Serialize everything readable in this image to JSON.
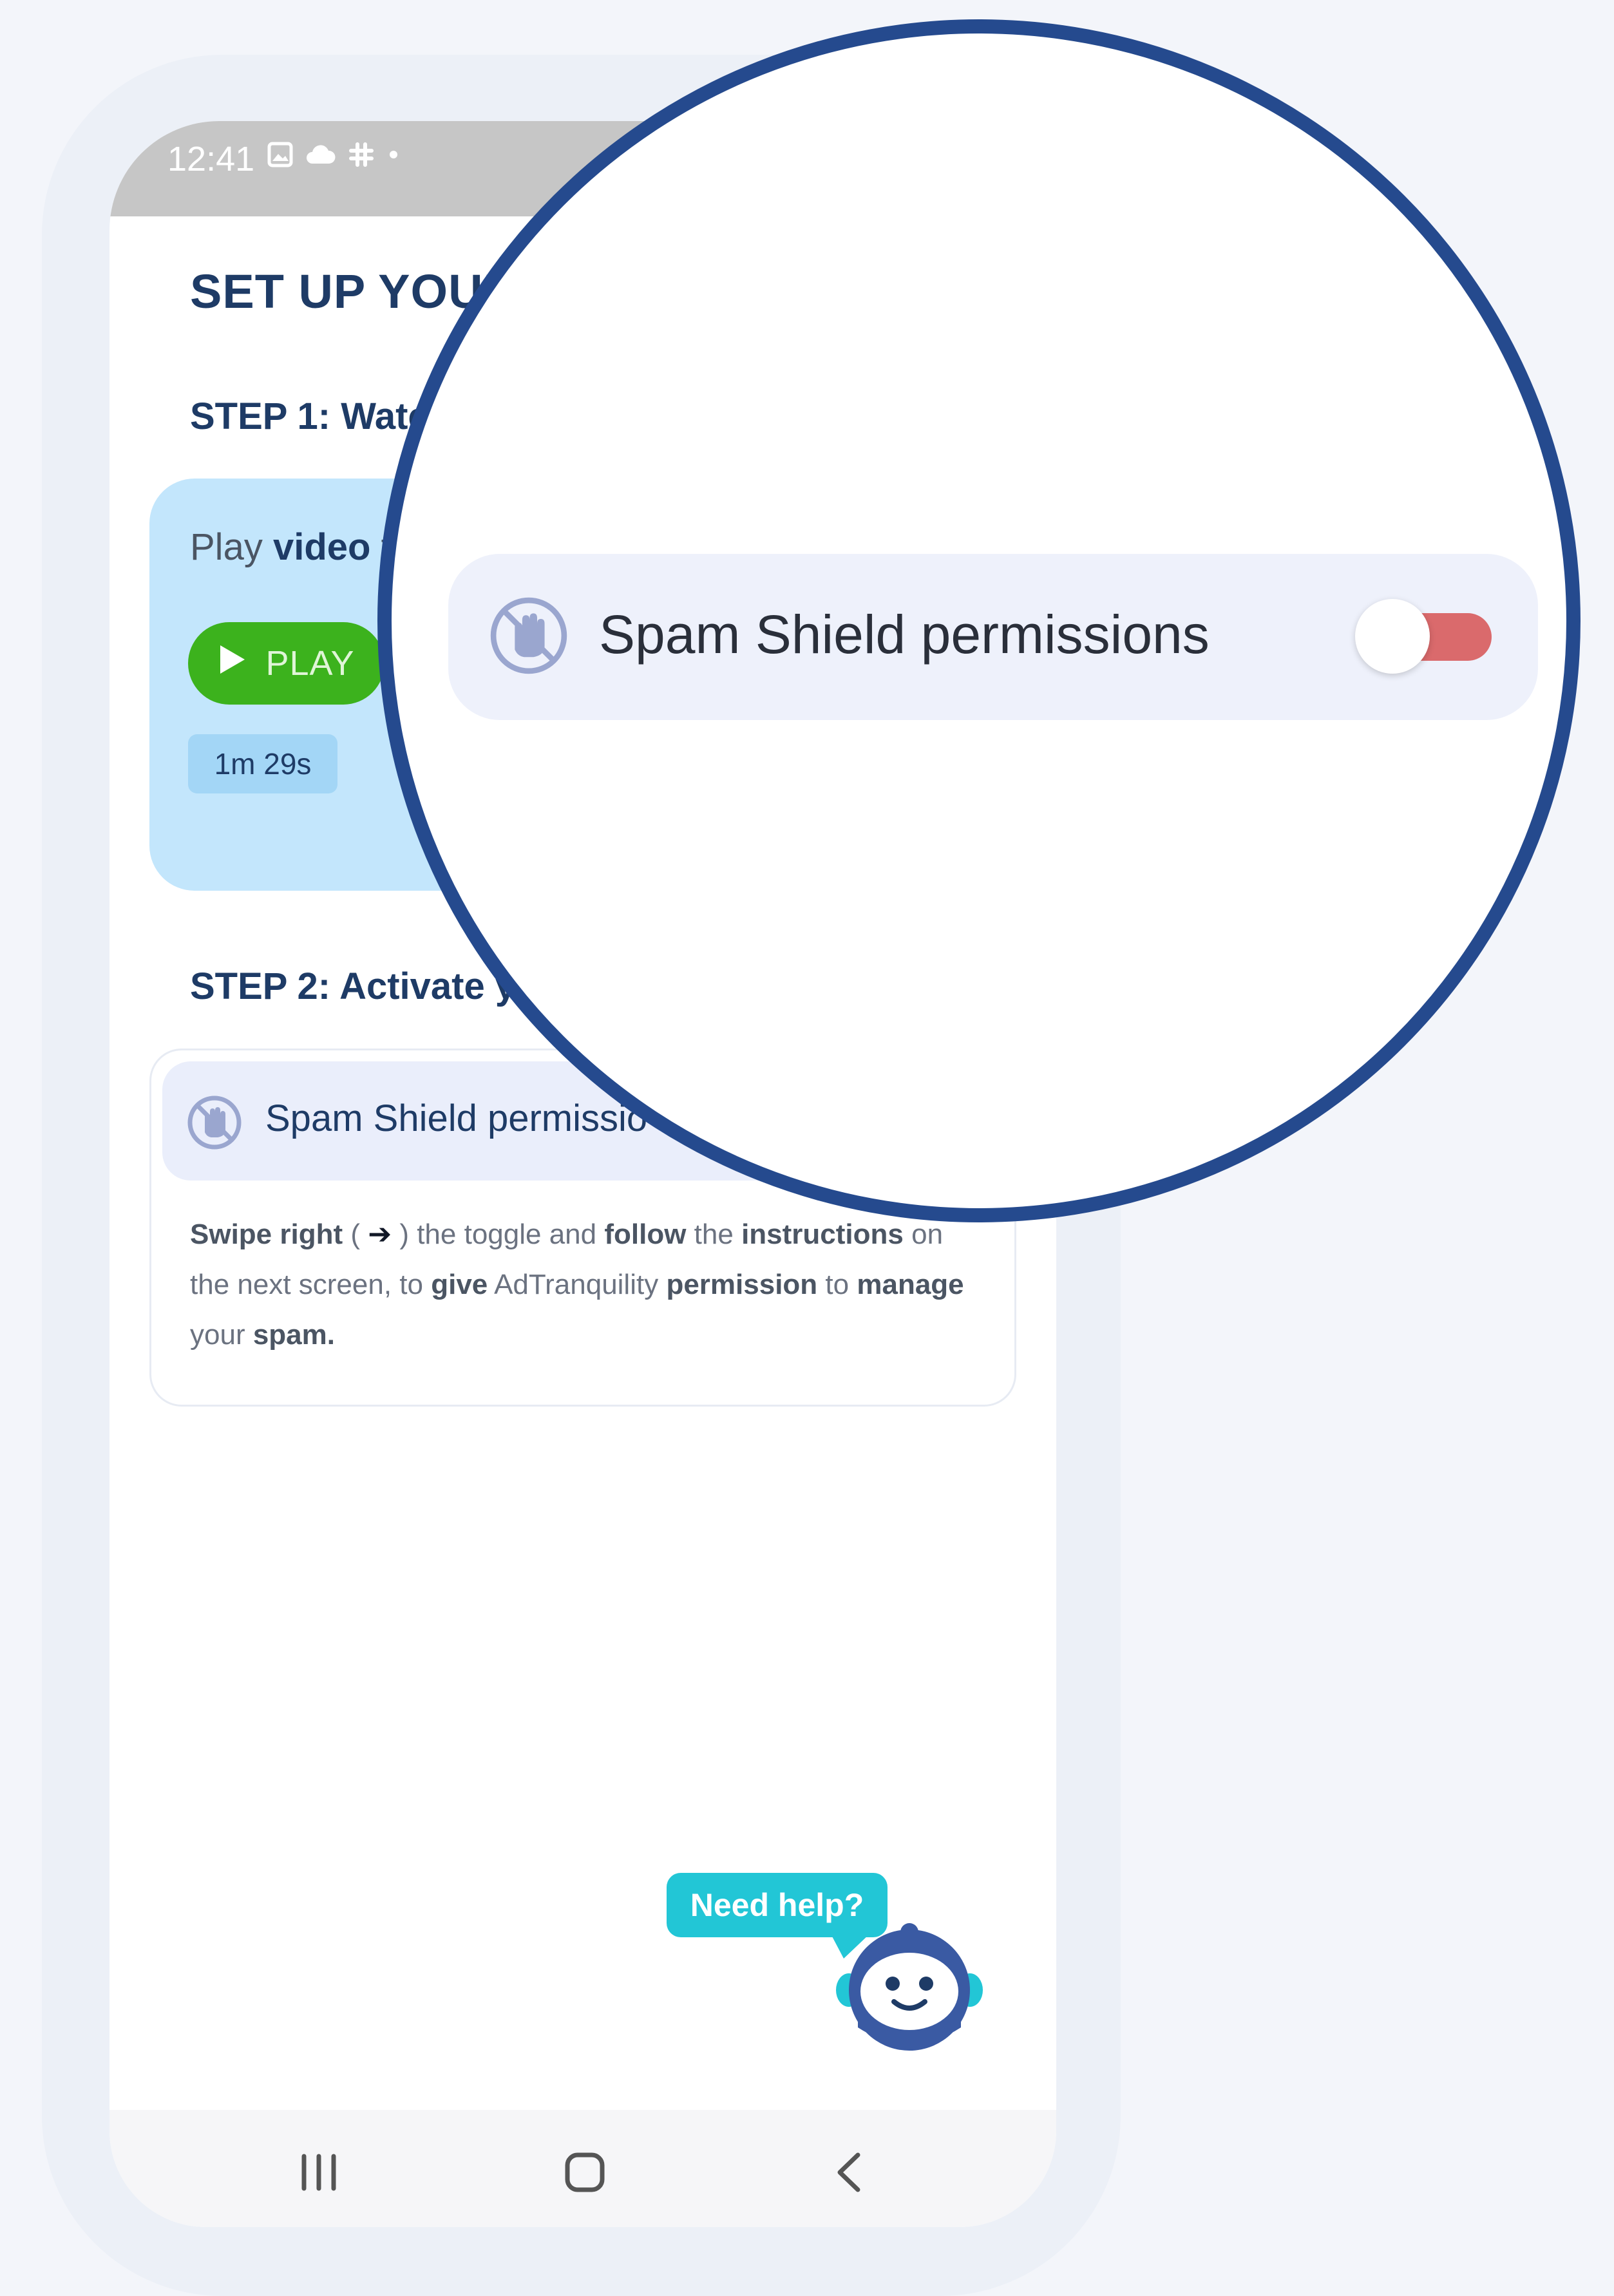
{
  "status_bar": {
    "time": "12:41"
  },
  "page": {
    "title": "SET UP YOUR"
  },
  "step1": {
    "label": "STEP 1: Watc",
    "play_prompt_prefix": "Play ",
    "play_prompt_bold": "video",
    "play_prompt_suffix": " t",
    "play_button": "PLAY",
    "duration": "1m 29s"
  },
  "step2": {
    "label": "STEP 2: Activate y",
    "permission_label": "Spam Shield permissio",
    "instructions": {
      "t1": "Swipe right",
      "t2": " ( ",
      "arrow": "➔",
      "t3": " ) the toggle and ",
      "t4": "follow",
      "t5": " the ",
      "t6": "instructions",
      "t7": " on the next screen, to ",
      "t8": "give",
      "t9": " AdTranquility ",
      "t10": "permission",
      "t11": " to ",
      "t12": "manage",
      "t13": " your ",
      "t14": "spam."
    }
  },
  "help": {
    "label": "Need help?"
  },
  "magnifier": {
    "permission_label": "Spam Shield permissions",
    "toggle_state": "off"
  },
  "colors": {
    "accent_navy": "#1e3b66",
    "magnifier_border": "#254a8e",
    "play_green": "#3cb21d",
    "toggle_red": "#da6a6c",
    "help_teal": "#22c6d6",
    "video_card_blue": "#c3e6fc"
  },
  "icons": {
    "permission": "hand-block-icon",
    "play": "play-triangle-icon",
    "nav_recents": "recents-icon",
    "nav_home": "home-icon",
    "nav_back": "back-chevron-icon"
  }
}
